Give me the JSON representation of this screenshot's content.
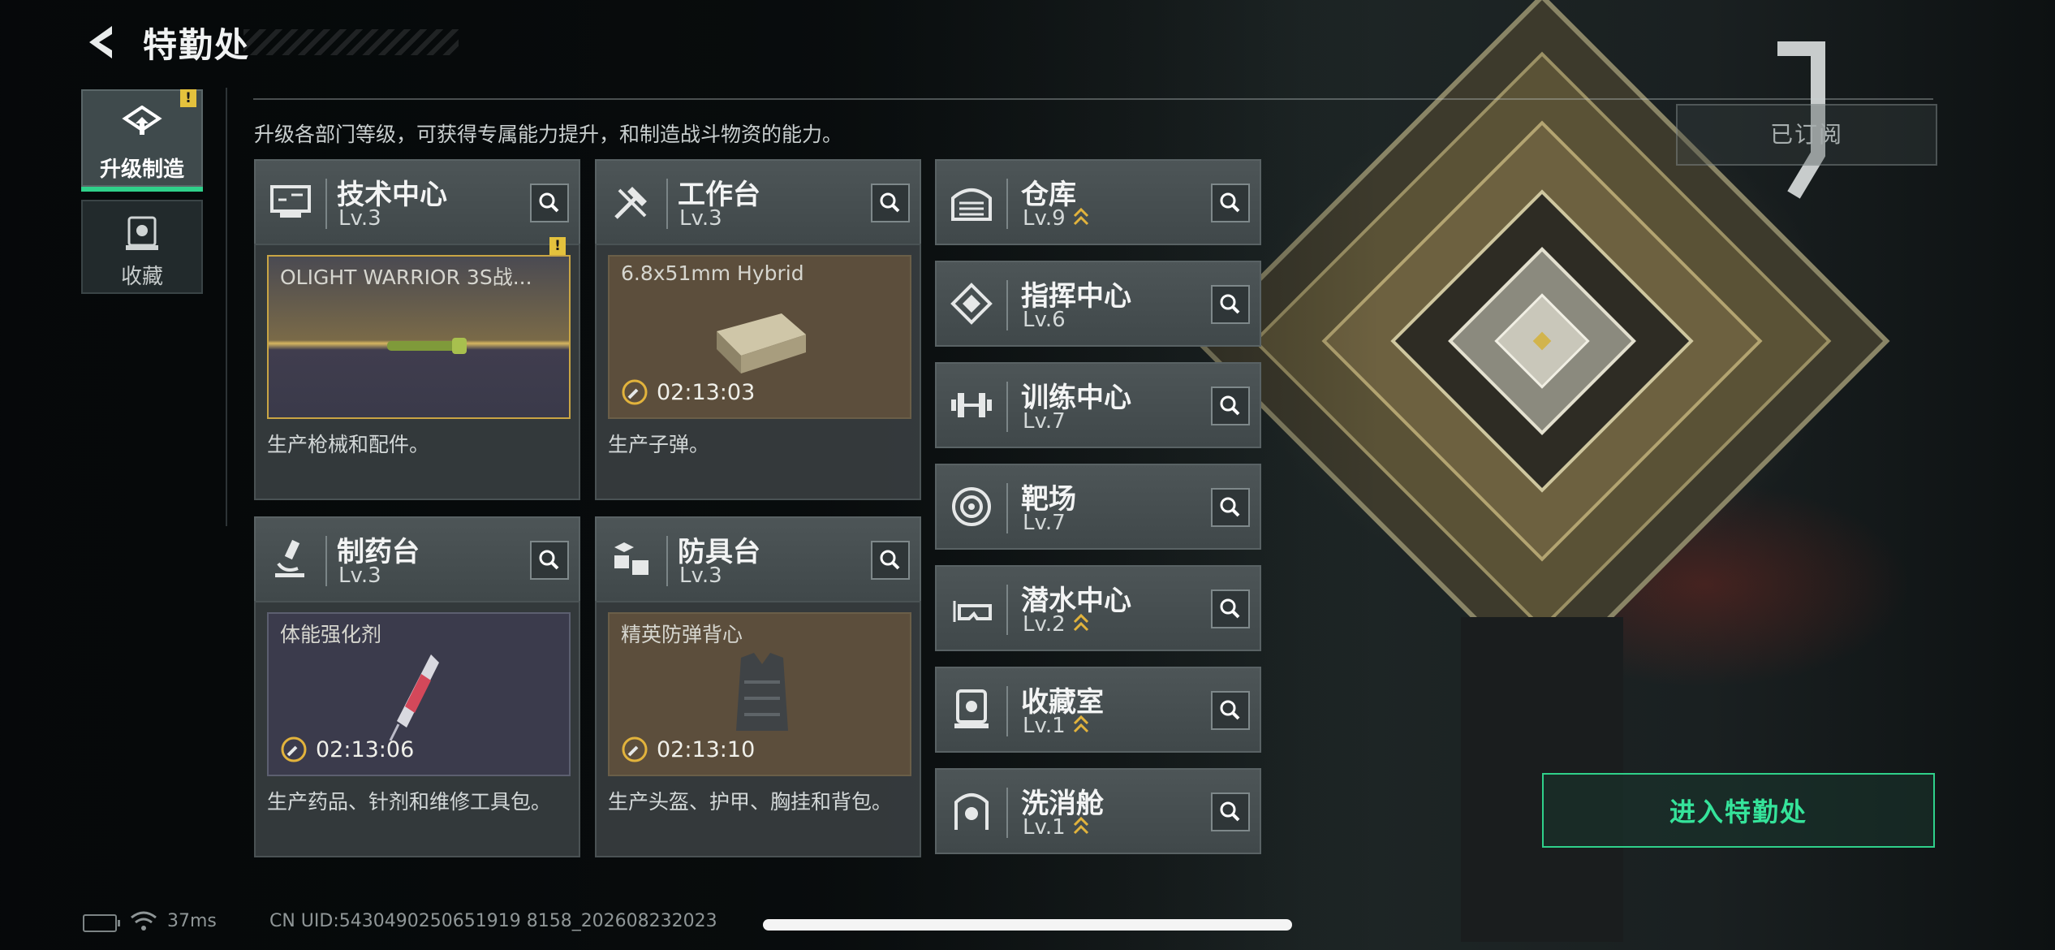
{
  "header": {
    "title": "特勤处"
  },
  "tabs": [
    {
      "label": "升级制造",
      "active": true,
      "alert": "!"
    },
    {
      "label": "收藏",
      "active": false
    }
  ],
  "description": "升级各部门等级，可获得专属能力提升，和制造战斗物资的能力。",
  "subscribed_label": "已订阅",
  "big_facilities": [
    {
      "name": "技术中心",
      "level": "Lv.3",
      "product": "OLIGHT WARRIOR 3S战...",
      "timer": "",
      "alert": "!",
      "desc": "生产枪械和配件。"
    },
    {
      "name": "工作台",
      "level": "Lv.3",
      "product": "6.8x51mm Hybrid",
      "timer": "02:13:03",
      "desc": "生产子弹。"
    },
    {
      "name": "制药台",
      "level": "Lv.3",
      "product": "体能强化剂",
      "timer": "02:13:06",
      "desc": "生产药品、针剂和维修工具包。"
    },
    {
      "name": "防具台",
      "level": "Lv.3",
      "product": "精英防弹背心",
      "timer": "02:13:10",
      "desc": "生产头盔、护甲、胸挂和背包。"
    }
  ],
  "small_facilities": [
    {
      "name": "仓库",
      "level": "Lv.9",
      "upgradable": true,
      "icon": "warehouse-icon"
    },
    {
      "name": "指挥中心",
      "level": "Lv.6",
      "upgradable": false,
      "icon": "command-center-icon"
    },
    {
      "name": "训练中心",
      "level": "Lv.7",
      "upgradable": false,
      "icon": "dumbbell-icon"
    },
    {
      "name": "靶场",
      "level": "Lv.7",
      "upgradable": false,
      "icon": "target-icon"
    },
    {
      "name": "潜水中心",
      "level": "Lv.2",
      "upgradable": true,
      "icon": "dive-mask-icon"
    },
    {
      "name": "收藏室",
      "level": "Lv.1",
      "upgradable": true,
      "icon": "collection-room-icon"
    },
    {
      "name": "洗消舱",
      "level": "Lv.1",
      "upgradable": true,
      "icon": "decontamination-icon"
    }
  ],
  "enter_button": "进入特勤处",
  "status": {
    "ping": "37ms",
    "uid": "CN UID:5430490250651919 8158_202608232023"
  },
  "colors": {
    "accent": "#2fd08a",
    "alert": "#e4c23d",
    "upgrade": "#e2b33c"
  }
}
